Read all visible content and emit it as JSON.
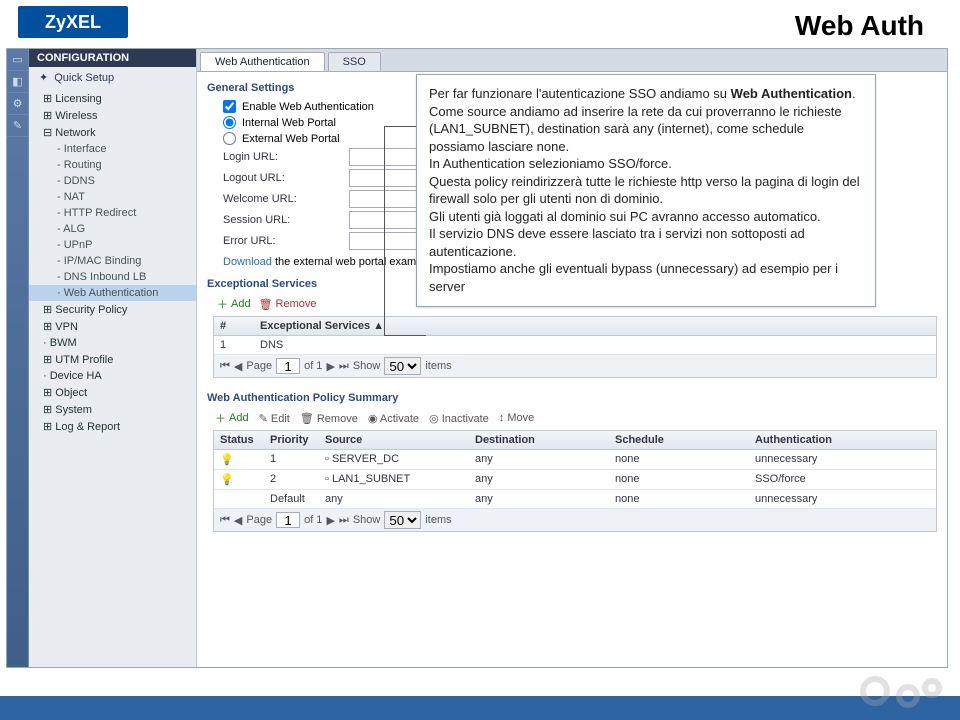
{
  "logo_text": "ZyXEL",
  "slide_title": "Web Auth",
  "sidebar_header": "CONFIGURATION",
  "quick_setup": "Quick Setup",
  "tree": {
    "items": [
      "Licensing",
      "Wireless",
      "Network",
      "DDNS",
      "NAT",
      "HTTP Redirect",
      "ALG",
      "UPnP",
      "IP/MAC Binding",
      "DNS Inbound LB",
      "Web Authentication",
      "Security Policy",
      "VPN",
      "BWM",
      "UTM Profile",
      "Device HA",
      "Object",
      "System",
      "Log & Report"
    ],
    "network_sub": [
      "Interface",
      "Routing"
    ]
  },
  "tabs": {
    "web_auth": "Web Authentication",
    "sso": "SSO"
  },
  "sections": {
    "general": "General Settings",
    "exceptional": "Exceptional Services",
    "policy": "Web Authentication Policy Summary"
  },
  "general": {
    "enable": "Enable Web Authentication",
    "internal": "Internal Web Portal",
    "external": "External Web Portal",
    "login": "Login URL:",
    "logout": "Logout URL:",
    "welcome": "Welcome URL:",
    "session": "Session URL:",
    "error": "Error URL:",
    "download_pre": "Download",
    "download_link": " the external web portal example."
  },
  "toolbar": {
    "add": "Add",
    "remove": "Remove",
    "edit": "Edit",
    "activate": "Activate",
    "inactivate": "Inactivate",
    "move": "Move"
  },
  "exc": {
    "hash": "#",
    "col": "Exceptional Services",
    "row_num": "1",
    "row_svc": "DNS"
  },
  "pager": {
    "page": "Page",
    "of": "of 1",
    "show": "Show",
    "items": "items",
    "val": "1",
    "size": "50"
  },
  "policy": {
    "cols": {
      "status": "Status",
      "priority": "Priority",
      "source": "Source",
      "destination": "Destination",
      "schedule": "Schedule",
      "auth": "Authentication"
    },
    "rows": [
      {
        "priority": "1",
        "source": "SERVER_DC",
        "destination": "any",
        "schedule": "none",
        "auth": "unnecessary"
      },
      {
        "priority": "2",
        "source": "LAN1_SUBNET",
        "destination": "any",
        "schedule": "none",
        "auth": "SSO/force"
      },
      {
        "priority": "Default",
        "source": "any",
        "destination": "any",
        "schedule": "none",
        "auth": "unnecessary"
      }
    ]
  },
  "callout": {
    "p1a": "Per far funzionare l'autenticazione SSO andiamo su ",
    "p1b": "Web Authentication",
    "p1c": ".",
    "p2": "Come source andiamo ad inserire la rete da cui proverranno le richieste (LAN1_SUBNET), destination sarà any (internet), come schedule possiamo lasciare none.",
    "p3": "In Authentication selezioniamo SSO/force.",
    "p4": "Questa policy reindirizzerà tutte le richieste http verso la pagina di login del firewall solo per gli utenti non di dominio.",
    "p5": "Gli utenti già loggati al dominio sui PC avranno accesso automatico.",
    "p6": "Il servizio DNS deve essere lasciato tra i servizi non sottoposti ad autenticazione.",
    "p7": "Impostiamo anche gli eventuali bypass (unnecessary) ad esempio per i server"
  }
}
